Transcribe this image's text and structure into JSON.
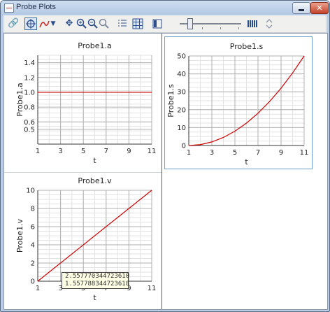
{
  "window": {
    "title": "Probe Plots"
  },
  "toolbar": {
    "icons": [
      "link-icon",
      "probe-select-icon",
      "probe-trace-icon",
      "dropdown-arrow-icon",
      "pan-icon",
      "zoom-in-icon",
      "zoom-out-icon",
      "zoom-reset-icon",
      "legend-icon",
      "grid-icon",
      "layout-icon",
      "slider",
      "bars-icon",
      "refresh-icon"
    ],
    "slider_value": 0.15
  },
  "colors": {
    "trace": "#cc0000",
    "grid": "#b0b0b0",
    "accent": "#3a6ea5"
  },
  "chart_data": [
    {
      "type": "line",
      "title": "Probe1.a",
      "xlabel": "t",
      "ylabel": "Probe1.a",
      "xlim": [
        1,
        11
      ],
      "ylim": [
        0.3,
        1.5
      ],
      "xticks": [
        1,
        3,
        5,
        7,
        9,
        11
      ],
      "yticks": [
        0.5,
        0.6,
        0.8,
        1.0,
        1.2,
        1.4
      ],
      "ytick_labels": [
        "0.5",
        "0.6",
        "0.8",
        "1.0",
        "1.2",
        "1.4"
      ],
      "series": [
        {
          "x": [
            1,
            11
          ],
          "y": [
            1.0,
            1.0
          ]
        }
      ]
    },
    {
      "type": "line",
      "title": "Probe1.s",
      "xlabel": "t",
      "ylabel": "Probe1.s",
      "xlim": [
        1,
        11
      ],
      "ylim": [
        0,
        50
      ],
      "xticks": [
        1,
        3,
        5,
        7,
        9,
        11
      ],
      "yticks": [
        0,
        10,
        20,
        30,
        40,
        50
      ],
      "ytick_labels": [
        "0",
        "10",
        "20",
        "30",
        "40",
        "50"
      ],
      "series": [
        {
          "x": [
            1,
            2,
            3,
            4,
            5,
            6,
            7,
            8,
            9,
            10,
            11
          ],
          "y": [
            0,
            0.5,
            2,
            4.5,
            8,
            12.5,
            18,
            24.5,
            32,
            40.5,
            50
          ]
        }
      ]
    },
    {
      "type": "line",
      "title": "Probe1.v",
      "xlabel": "t",
      "ylabel": "Probe1.v",
      "xlim": [
        1,
        11
      ],
      "ylim": [
        0,
        10
      ],
      "xticks": [
        1,
        3,
        5,
        7,
        9,
        11
      ],
      "yticks": [
        0,
        2,
        4,
        6,
        8,
        10
      ],
      "ytick_labels": [
        "0",
        "2",
        "4",
        "6",
        "8",
        "10"
      ],
      "series": [
        {
          "x": [
            1,
            11
          ],
          "y": [
            0,
            10
          ]
        }
      ]
    }
  ],
  "tooltip": {
    "line1": "2.557770344723610",
    "line2": "1.557788344723618"
  }
}
